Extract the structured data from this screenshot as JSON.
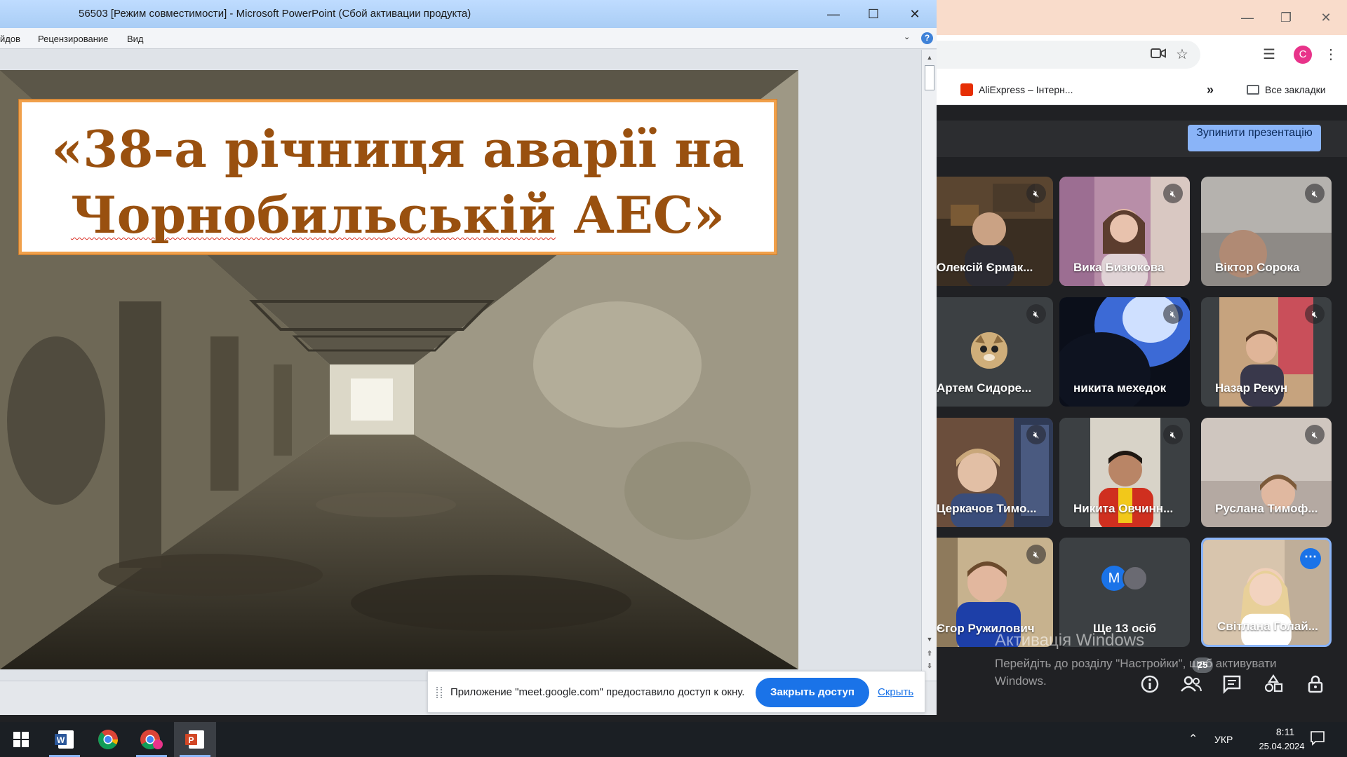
{
  "powerpoint": {
    "title": "56503 [Режим совместимости]  -  Microsoft PowerPoint (Сбой активации продукта)",
    "ribbon_tabs": [
      "йдов",
      "Рецензирование",
      "Вид"
    ],
    "slide": {
      "title_line1": "«38-а  річниця аварії на",
      "title_line2_word": "Чорнобильській",
      "title_line2_rest": " АЕС»"
    }
  },
  "share_bar": {
    "message": "Приложение \"meet.google.com\" предоставило доступ к окну.",
    "close_button": "Закрыть доступ",
    "hide_link": "Скрыть"
  },
  "chrome": {
    "bookmarks": {
      "aliexpress": "AliExpress – Інтерн...",
      "all_bookmarks": "Все закладки"
    },
    "profile_initial": "C"
  },
  "meet": {
    "stop_presenting": "Зупинити презентацію",
    "participants": [
      {
        "name": "Олексій Єрмак...",
        "muted": true
      },
      {
        "name": "Вика Бизюкова",
        "muted": true
      },
      {
        "name": "Віктор Сорока",
        "muted": true
      },
      {
        "name": "Артем Сидоре...",
        "muted": true
      },
      {
        "name": "никита мехедок",
        "muted": true
      },
      {
        "name": "Назар Рекун",
        "muted": true
      },
      {
        "name": "Церкачов Тимо...",
        "muted": true
      },
      {
        "name": "Никита Овчинн...",
        "muted": true
      },
      {
        "name": "Руслана Тимоф...",
        "muted": true
      },
      {
        "name": "Єгор Ружилович",
        "muted": true
      },
      {
        "name": "Ще 13 осіб",
        "muted": false
      },
      {
        "name": "Світлана Голай...",
        "muted": false
      }
    ],
    "more_avatar_letter": "M",
    "participant_count": "25",
    "activation_title": "Активація Windows",
    "activation_line1": "Перейдіть до розділу \"Настройки\", щоб активувати",
    "activation_line2": "Windows."
  },
  "taskbar": {
    "language": "УКР",
    "time": "8:11",
    "date": "25.04.2024"
  },
  "colors": {
    "title_text": "#99500f",
    "title_border": "#f0a04b",
    "meet_accent": "#8ab4f8",
    "share_button": "#1a73e8"
  }
}
